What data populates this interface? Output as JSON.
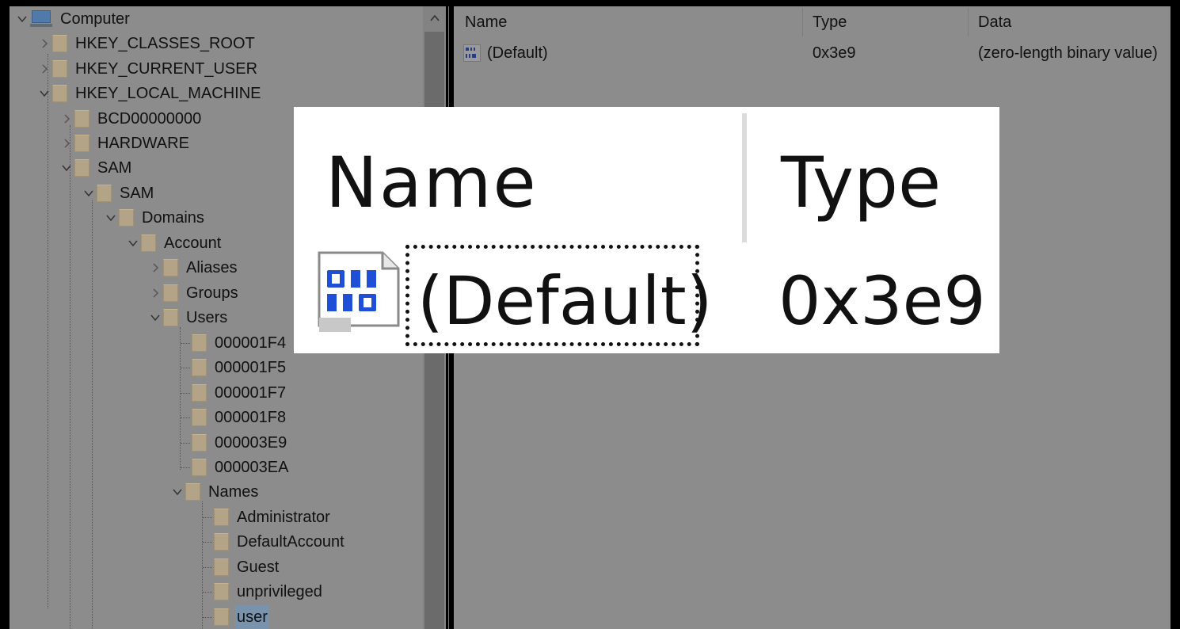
{
  "tree": {
    "root_label": "Computer",
    "hives": [
      {
        "label": "HKEY_CLASSES_ROOT"
      },
      {
        "label": "HKEY_CURRENT_USER"
      },
      {
        "label": "HKEY_LOCAL_MACHINE"
      }
    ],
    "hklm_children": [
      {
        "label": "BCD00000000"
      },
      {
        "label": "HARDWARE"
      },
      {
        "label": "SAM"
      }
    ],
    "sam_sub": "SAM",
    "domains": "Domains",
    "account": "Account",
    "account_children": [
      {
        "label": "Aliases"
      },
      {
        "label": "Groups"
      },
      {
        "label": "Users"
      }
    ],
    "user_rids": [
      {
        "label": "000001F4"
      },
      {
        "label": "000001F5"
      },
      {
        "label": "000001F7"
      },
      {
        "label": "000001F8"
      },
      {
        "label": "000003E9"
      },
      {
        "label": "000003EA"
      }
    ],
    "names": "Names",
    "name_entries": [
      {
        "label": "Administrator"
      },
      {
        "label": "DefaultAccount"
      },
      {
        "label": "Guest"
      },
      {
        "label": "unprivileged"
      },
      {
        "label": "user",
        "selected": true
      }
    ]
  },
  "list": {
    "columns": {
      "name": "Name",
      "type": "Type",
      "data": "Data"
    },
    "rows": [
      {
        "name": "(Default)",
        "type": "0x3e9",
        "data": "(zero-length binary value)",
        "icon": "binary-value-icon"
      }
    ]
  },
  "zoom": {
    "name_header": "Name",
    "type_header": "Type",
    "value_name": "(Default)",
    "value_type": "0x3e9",
    "icon": "binary-value-icon"
  },
  "colors": {
    "dimmed_pane": "#8c8c8c",
    "folder": "#b3a487",
    "selection": "#7a93ad",
    "binary_icon_blue": "#1f4fd6"
  }
}
